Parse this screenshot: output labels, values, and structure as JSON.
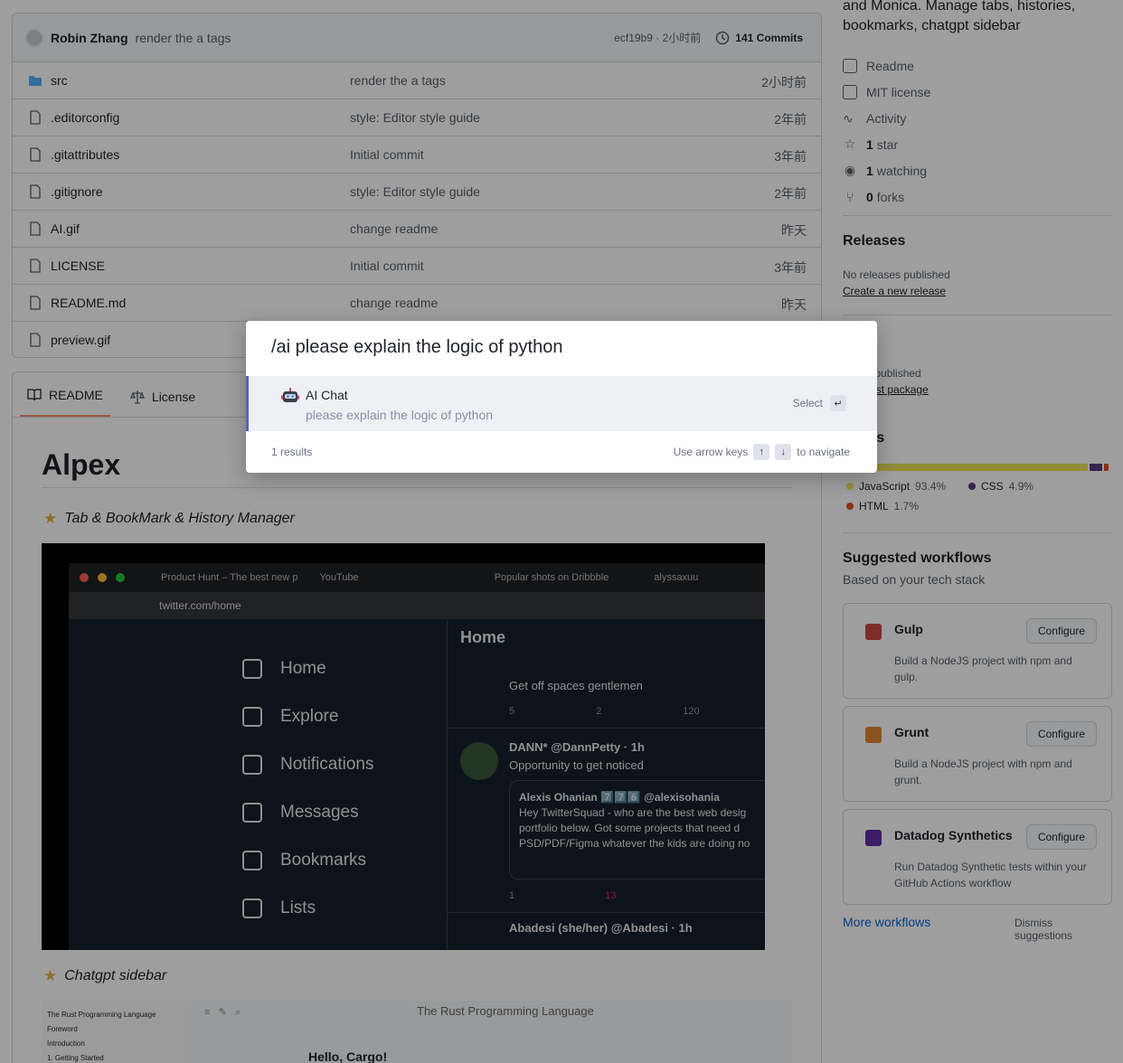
{
  "commit": {
    "author": "Robin Zhang",
    "message": "render the a tags",
    "hash_time": "ecf19b9 · 2小时前",
    "commits_count": "141 Commits"
  },
  "files": [
    {
      "name": "src",
      "type": "folder",
      "message": "render the a tags",
      "time": "2小时前"
    },
    {
      "name": ".editorconfig",
      "type": "file",
      "message": "style: Editor style guide",
      "time": "2年前"
    },
    {
      "name": ".gitattributes",
      "type": "file",
      "message": "Initial commit",
      "time": "3年前"
    },
    {
      "name": ".gitignore",
      "type": "file",
      "message": "style: Editor style guide",
      "time": "2年前"
    },
    {
      "name": "AI.gif",
      "type": "file",
      "message": "change readme",
      "time": "昨天"
    },
    {
      "name": "LICENSE",
      "type": "file",
      "message": "Initial commit",
      "time": "3年前"
    },
    {
      "name": "README.md",
      "type": "file",
      "message": "change readme",
      "time": "昨天"
    },
    {
      "name": "preview.gif",
      "type": "file",
      "message": "",
      "time": ""
    }
  ],
  "readme": {
    "tab_readme": "README",
    "tab_license": "License",
    "title": "Alpex",
    "subtitle1": "Tab & BookMark & History Manager",
    "subtitle2": "Chatgpt sidebar"
  },
  "screenshot": {
    "tabs": [
      "Product Hunt – The best new p",
      "YouTube",
      "Popular shots on Dribbble",
      "alyssaxuu"
    ],
    "url": "twitter.com/home",
    "nav": [
      "Home",
      "Explore",
      "Notifications",
      "Messages",
      "Bookmarks",
      "Lists"
    ],
    "feed_title": "Home",
    "feed_text1": "Get off spaces gentlemen",
    "feed_user": "DANN* @DannPetty · 1h",
    "feed_text2": "Opportunity to get noticed",
    "quote_user": "Alexis Ohanian 7️⃣7️⃣6️⃣ @alexisohania",
    "quote_text": "Hey TwitterSquad - who are the best web desig portfolio below. Got some projects that need d PSD/PDF/Figma whatever the kids are doing no",
    "feed_user2": "Abadesi (she/her) @Abadesi · 1h",
    "stats1": [
      "5",
      "2",
      "120"
    ],
    "stats2": [
      "1",
      "13"
    ]
  },
  "sidebar_preview": {
    "title": "The Rust Programming Language",
    "toc": [
      "The Rust Programming Language",
      "Foreword",
      "Introduction",
      "1. Getting Started"
    ],
    "hello": "Hello, Cargo!"
  },
  "about": {
    "text": "and Monica. Manage tabs, histories, bookmarks, chatgpt sidebar",
    "readme": "Readme",
    "license": "MIT license",
    "activity": "Activity",
    "stars_n": "1",
    "stars": "star",
    "watching_n": "1",
    "watching": "watching",
    "forks_n": "0",
    "forks": "forks"
  },
  "releases": {
    "title": "Releases",
    "none": "No releases published",
    "create": "Create a new release"
  },
  "packages": {
    "title": "ages",
    "none": "kages published",
    "create": "your first package"
  },
  "languages": {
    "title": "uages",
    "items": [
      {
        "name": "JavaScript",
        "pct": "93.4%",
        "color": "#f1e05a",
        "value": 93.4
      },
      {
        "name": "CSS",
        "pct": "4.9%",
        "color": "#563d7c",
        "value": 4.9
      },
      {
        "name": "HTML",
        "pct": "1.7%",
        "color": "#e34c26",
        "value": 1.7
      }
    ]
  },
  "workflows": {
    "title": "Suggested workflows",
    "subtitle": "Based on your tech stack",
    "items": [
      {
        "name": "Gulp",
        "button": "Configure",
        "desc": "Build a NodeJS project with npm and gulp.",
        "color": "#cf4647"
      },
      {
        "name": "Grunt",
        "button": "Configure",
        "desc": "Build a NodeJS project with npm and grunt.",
        "color": "#e48632"
      },
      {
        "name": "Datadog Synthetics",
        "button": "Configure",
        "desc": "Run Datadog Synthetic tests within your GitHub Actions workflow",
        "color": "#632ca6"
      }
    ],
    "more": "More workflows",
    "dismiss": "Dismiss suggestions"
  },
  "palette": {
    "query": "/ai please explain the logic of python",
    "item_title": "AI Chat",
    "item_sub": "please explain the logic of python",
    "select": "Select",
    "results": "1 results",
    "nav_hint_pre": "Use arrow keys",
    "nav_hint_post": "to navigate"
  }
}
